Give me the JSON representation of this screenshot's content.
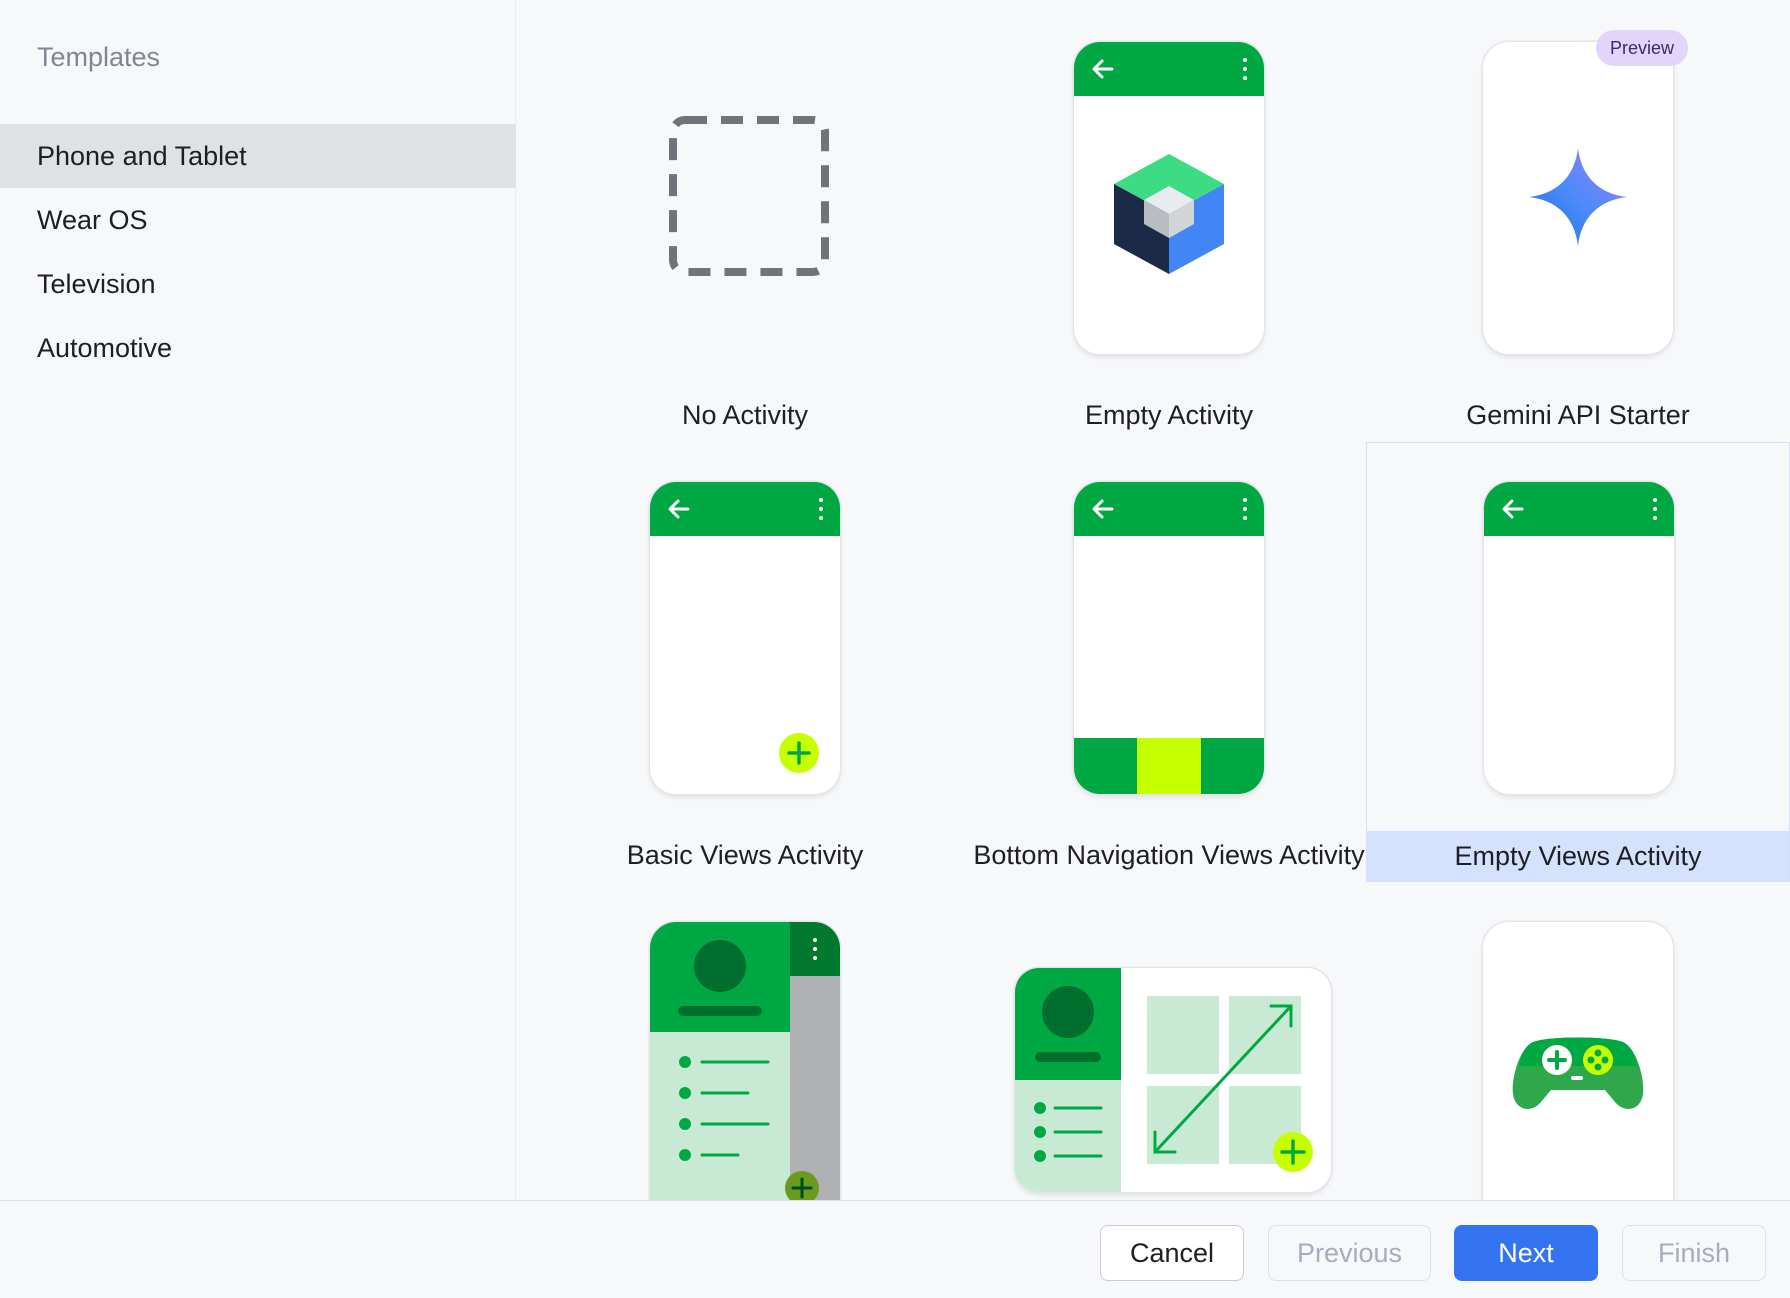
{
  "sidebar": {
    "title": "Templates",
    "items": [
      {
        "label": "Phone and Tablet",
        "selected": true
      },
      {
        "label": "Wear OS",
        "selected": false
      },
      {
        "label": "Television",
        "selected": false
      },
      {
        "label": "Automotive",
        "selected": false
      }
    ]
  },
  "templates": [
    {
      "label": "No Activity",
      "icon": "dashed-square-icon"
    },
    {
      "label": "Empty Activity",
      "icon": "compose-cube-icon"
    },
    {
      "label": "Gemini API Starter",
      "icon": "gemini-sparkle-icon",
      "badge": "Preview"
    },
    {
      "label": "Basic Views Activity",
      "icon": "phone-fab-icon"
    },
    {
      "label": "Bottom Navigation Views Activity",
      "icon": "phone-bottom-nav-icon"
    },
    {
      "label": "Empty Views Activity",
      "icon": "phone-blank-icon",
      "selected": true
    },
    {
      "label": "",
      "icon": "navigation-drawer-icon"
    },
    {
      "label": "",
      "icon": "responsive-layout-icon"
    },
    {
      "label": "",
      "icon": "game-controller-icon"
    }
  ],
  "footer": {
    "cancel": "Cancel",
    "previous": "Previous",
    "next": "Next",
    "finish": "Finish"
  },
  "colors": {
    "accent": "#3574f0",
    "green": "#00a844",
    "dark_green": "#006e2c",
    "lime": "#c6ff00",
    "light_green": "#c8ead4",
    "selection": "#d4e2ff"
  }
}
